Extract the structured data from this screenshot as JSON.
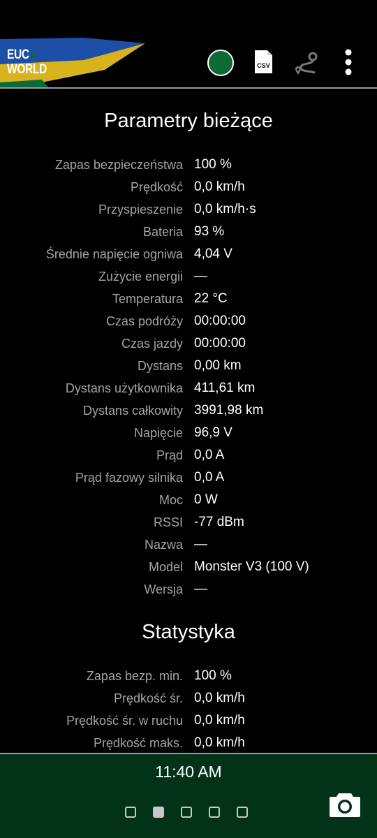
{
  "app": {
    "logo_line1": "EUC",
    "logo_line2": "WORLD",
    "accent_color": "#0c6b35",
    "bottom_panel_color": "#023318"
  },
  "toolbar": {
    "status_icon": "connection-status-circle",
    "csv_icon_label": "CSV",
    "route_icon": "route-icon",
    "menu_icon": "more-vert-icon"
  },
  "current": {
    "title": "Parametry bieżące",
    "rows": [
      {
        "label": "Zapas bezpieczeństwa",
        "value": "100 %"
      },
      {
        "label": "Prędkość",
        "value": "0,0 km/h"
      },
      {
        "label": "Przyspieszenie",
        "value": "0,0 km/h·s"
      },
      {
        "label": "Bateria",
        "value": "93 %"
      },
      {
        "label": "Średnie napięcie ogniwa",
        "value": "4,04 V"
      },
      {
        "label": "Zużycie energii",
        "value": "—"
      },
      {
        "label": "Temperatura",
        "value": "22 °C"
      },
      {
        "label": "Czas podróży",
        "value": "00:00:00"
      },
      {
        "label": "Czas jazdy",
        "value": "00:00:00"
      },
      {
        "label": "Dystans",
        "value": "0,00 km"
      },
      {
        "label": "Dystans użytkownika",
        "value": "411,61 km"
      },
      {
        "label": "Dystans całkowity",
        "value": "3991,98 km"
      },
      {
        "label": "Napięcie",
        "value": "96,9 V"
      },
      {
        "label": "Prąd",
        "value": "0,0 A"
      },
      {
        "label": "Prąd fazowy silnika",
        "value": "0,0 A"
      },
      {
        "label": "Moc",
        "value": "0 W"
      },
      {
        "label": "RSSI",
        "value": "-77 dBm"
      },
      {
        "label": "Nazwa",
        "value": "—"
      },
      {
        "label": "Model",
        "value": "Monster V3 (100 V)"
      },
      {
        "label": "Wersja",
        "value": "—"
      }
    ]
  },
  "stats": {
    "title": "Statystyka",
    "rows": [
      {
        "label": "Zapas bezp. min.",
        "value": "100 %"
      },
      {
        "label": "Prędkość śr.",
        "value": "0,0 km/h"
      },
      {
        "label": "Prędkość śr. w ruchu",
        "value": "0,0 km/h"
      },
      {
        "label": "Prędkość maks.",
        "value": "0,0 km/h"
      }
    ]
  },
  "bottom": {
    "clock": "11:40 AM",
    "pages_total": 5,
    "active_page": 2,
    "camera_icon": "camera-icon"
  }
}
